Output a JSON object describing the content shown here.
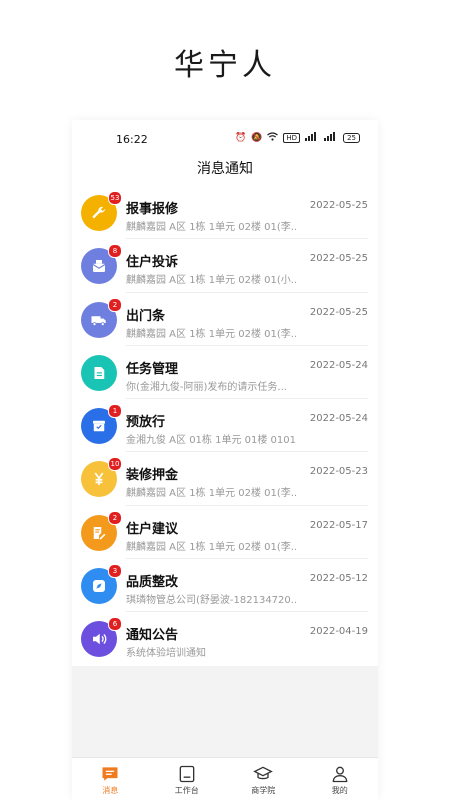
{
  "app_title": "华宁人",
  "status_bar": {
    "time": "16:22",
    "network_label": "HD",
    "battery": "25"
  },
  "header": {
    "title": "消息通知"
  },
  "messages": [
    {
      "title": "报事报修",
      "subtitle": "麒麟嘉园 A区 1栋 1单元 02楼 01(李...",
      "date": "2022-05-25",
      "badge": "53",
      "icon": "wrench-icon",
      "color": "#f5b100"
    },
    {
      "title": "住户投诉",
      "subtitle": "麒麟嘉园 A区 1栋 1单元 02楼 01(小...",
      "date": "2022-05-25",
      "badge": "8",
      "icon": "mail-icon",
      "color": "#6f7fe0"
    },
    {
      "title": "出门条",
      "subtitle": "麒麟嘉园 A区 1栋 1单元 02楼 01(李...",
      "date": "2022-05-25",
      "badge": "2",
      "icon": "truck-icon",
      "color": "#6f7fe0"
    },
    {
      "title": "任务管理",
      "subtitle": "你(金湘九俊-阿丽)发布的请示任务...",
      "date": "2022-05-24",
      "badge": "",
      "icon": "document-icon",
      "color": "#19c4b4"
    },
    {
      "title": "预放行",
      "subtitle": "金湘九俊 A区 01栋 1单元 01楼 0101(...",
      "date": "2022-05-24",
      "badge": "1",
      "icon": "box-icon",
      "color": "#2a6fe8"
    },
    {
      "title": "装修押金",
      "subtitle": "麒麟嘉园 A区 1栋 1单元 02楼 01(李...",
      "date": "2022-05-23",
      "badge": "10",
      "icon": "yen-icon",
      "color": "#f7c23a"
    },
    {
      "title": "住户建议",
      "subtitle": "麒麟嘉园 A区 1栋 1单元 02楼 01(李...",
      "date": "2022-05-17",
      "badge": "2",
      "icon": "edit-icon",
      "color": "#f39a1c"
    },
    {
      "title": "品质整改",
      "subtitle": "琪璘物管总公司(舒晏波-182134720...",
      "date": "2022-05-12",
      "badge": "3",
      "icon": "compass-icon",
      "color": "#2f8cf0"
    },
    {
      "title": "通知公告",
      "subtitle": "系统体验培训通知",
      "date": "2022-04-19",
      "badge": "6",
      "icon": "speaker-icon",
      "color": "#6d4fe0"
    }
  ],
  "tabs": [
    {
      "label": "消息",
      "icon": "message-icon",
      "active": true
    },
    {
      "label": "工作台",
      "icon": "workbench-icon",
      "active": false
    },
    {
      "label": "商学院",
      "icon": "graduation-cap-icon",
      "active": false
    },
    {
      "label": "我的",
      "icon": "user-icon",
      "active": false
    }
  ],
  "colors": {
    "accent": "#f07a1e",
    "badge": "#e02020"
  }
}
